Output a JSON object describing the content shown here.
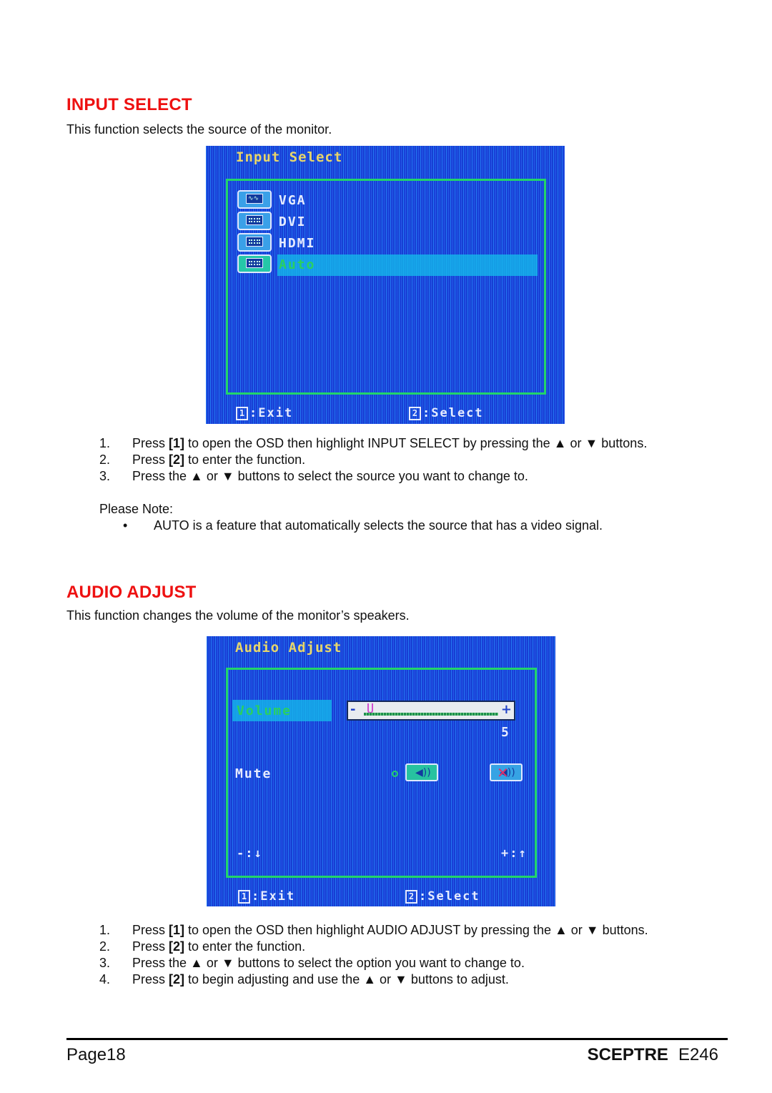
{
  "sections": {
    "input_select": {
      "heading": "INPUT SELECT",
      "intro": "This function selects the source of the monitor.",
      "osd": {
        "title": "Input Select",
        "options": [
          {
            "label": "VGA",
            "icon": "vga-monitor-icon",
            "selected": false
          },
          {
            "label": "DVI",
            "icon": "dvi-monitor-icon",
            "selected": false
          },
          {
            "label": "HDMI",
            "icon": "hdmi-monitor-icon",
            "selected": false
          },
          {
            "label": "Auto",
            "icon": "auto-monitor-icon",
            "selected": true
          }
        ],
        "exit_key": "1",
        "exit_label": ":Exit",
        "select_key": "2",
        "select_label": ":Select"
      },
      "steps": [
        {
          "num": "1.",
          "pre": "Press ",
          "key": "[1]",
          "post": " to open the OSD then highlight INPUT SELECT by pressing the ▲ or ▼ buttons."
        },
        {
          "num": "2.",
          "pre": "Press ",
          "key": "[2]",
          "post": " to enter the function."
        },
        {
          "num": "3.",
          "pre": "Press the ▲ or ▼ buttons to select the source you want to change to.",
          "key": "",
          "post": ""
        }
      ],
      "note_label": "Please Note:",
      "note_bullet": "•",
      "note_text": "AUTO is a feature that automatically selects the source that has a video signal."
    },
    "audio_adjust": {
      "heading": "AUDIO ADJUST",
      "intro": "This function changes the volume of the monitor’s speakers.",
      "osd": {
        "title": "Audio Adjust",
        "volume_label": "Volume",
        "volume_minus": "-",
        "volume_plus": "+",
        "volume_value": "5",
        "volume_fraction": 0.05,
        "mute_label": "Mute",
        "mute_state": "off",
        "down_hint": "-:",
        "down_icon": "↓",
        "up_hint": "+:",
        "up_icon": "↑",
        "exit_key": "1",
        "exit_label": ":Exit",
        "select_key": "2",
        "select_label": ":Select"
      },
      "steps": [
        {
          "num": "1.",
          "pre": "Press ",
          "key": "[1]",
          "post": " to open the OSD then highlight AUDIO ADJUST by pressing the ▲ or ▼ buttons."
        },
        {
          "num": "2.",
          "pre": "Press ",
          "key": "[2]",
          "post": " to enter the function."
        },
        {
          "num": "3.",
          "pre": "Press the ▲ or ▼ buttons to select the option you want to change to.",
          "key": "",
          "post": ""
        },
        {
          "num": "4.",
          "pre": "Press ",
          "key": "[2]",
          "post": " to begin adjusting and use the ▲ or ▼ buttons to adjust."
        }
      ]
    }
  },
  "footer": {
    "page": "Page18",
    "brand": "SCEPTRE",
    "model": "E246"
  },
  "colors": {
    "heading": "#ee1111",
    "osd_background": "#1f4ee0",
    "osd_frame": "#22d46a",
    "osd_title": "#e8d66a",
    "osd_highlight": "#14bee b"
  }
}
